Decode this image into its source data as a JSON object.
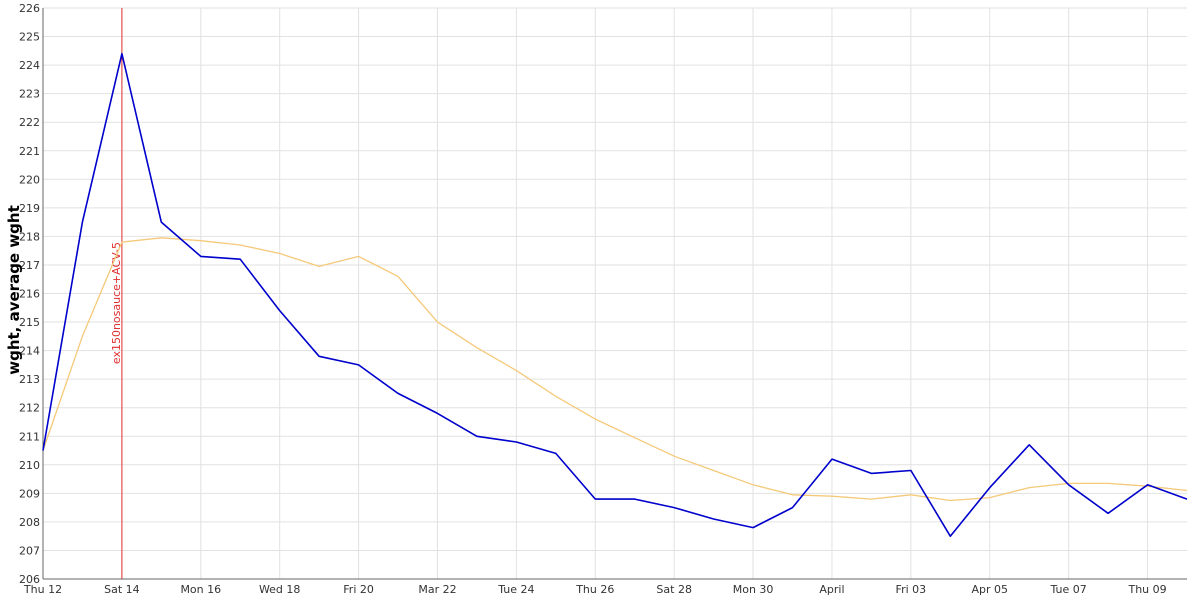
{
  "chart_data": {
    "type": "line",
    "ylabel": "wght, average wght",
    "xlabel": "",
    "ylim": [
      206,
      226
    ],
    "yticks": [
      206,
      207,
      208,
      209,
      210,
      211,
      212,
      213,
      214,
      215,
      216,
      217,
      218,
      219,
      220,
      221,
      222,
      223,
      224,
      225,
      226
    ],
    "x_ticks": [
      "Thu 12",
      "Sat 14",
      "Mon 16",
      "Wed 18",
      "Fri 20",
      "Mar 22",
      "Tue 24",
      "Thu 26",
      "Sat 28",
      "Mon 30",
      "April",
      "Fri 03",
      "Apr 05",
      "Tue 07",
      "Thu 09"
    ],
    "x_dates": [
      "Mar 12",
      "Mar 13",
      "Mar 14",
      "Mar 15",
      "Mar 16",
      "Mar 17",
      "Mar 18",
      "Mar 19",
      "Mar 20",
      "Mar 21",
      "Mar 22",
      "Mar 23",
      "Mar 24",
      "Mar 25",
      "Mar 26",
      "Mar 27",
      "Mar 28",
      "Mar 29",
      "Mar 30",
      "Mar 31",
      "Apr 01",
      "Apr 02",
      "Apr 03",
      "Apr 04",
      "Apr 05",
      "Apr 06",
      "Apr 07",
      "Apr 08",
      "Apr 09",
      "Apr 10"
    ],
    "grid": true,
    "series": [
      {
        "color": "#0000cc",
        "values": [
          210.5,
          218.5,
          224.4,
          218.5,
          217.3,
          217.2,
          215.4,
          213.8,
          213.5,
          212.5,
          211.8,
          211.0,
          210.8,
          210.4,
          208.8,
          208.8,
          208.5,
          208.1,
          207.8,
          208.5,
          210.2,
          209.7,
          209.8,
          207.5,
          209.2,
          210.7,
          209.3,
          208.3,
          209.3,
          208.8
        ]
      },
      {
        "color": "#f5c97a",
        "values": [
          210.5,
          214.5,
          217.8,
          217.95,
          217.85,
          217.7,
          217.4,
          216.95,
          217.3,
          216.6,
          215.0,
          214.1,
          213.3,
          212.4,
          211.6,
          210.95,
          210.3,
          209.8,
          209.3,
          208.95,
          208.9,
          208.8,
          208.95,
          208.75,
          208.85,
          209.2,
          209.35,
          209.35,
          209.25,
          209.1
        ]
      }
    ],
    "annotations": [
      {
        "x": "Mar 14",
        "text": "ex150nosauce+ACV-5",
        "color": "#e03030"
      }
    ]
  }
}
